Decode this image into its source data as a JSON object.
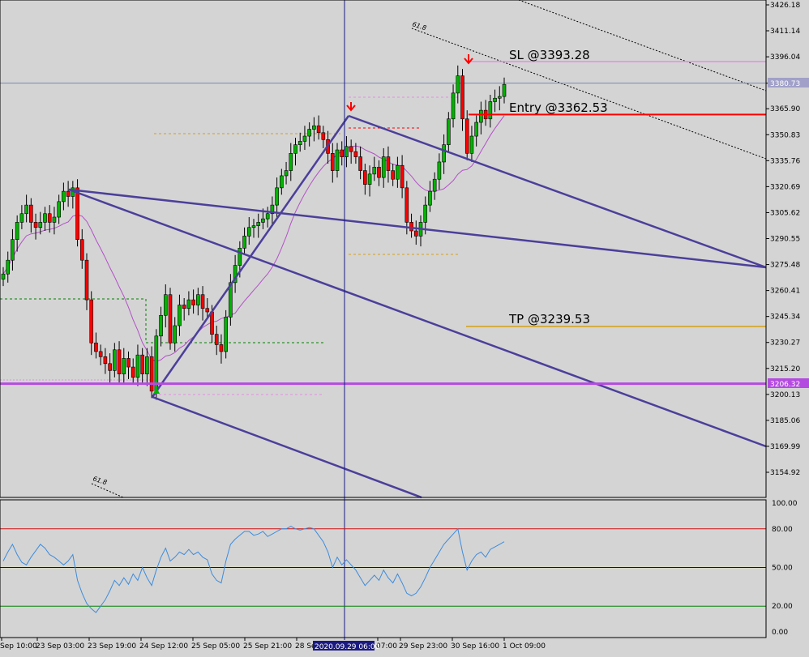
{
  "colors": {
    "background": "#d4d4d4",
    "axis": "#000000",
    "grid_text": "#000000",
    "channel": "#4b3f9a",
    "fib": "#000000",
    "sl_line": "#e58be5",
    "entry_line": "#ff0000",
    "tp_line": "#d4a017",
    "support_line": "#b44be0",
    "ma_line": "#b450c8",
    "rsi_line": "#3c8cdc",
    "rsi_80": "#d01010",
    "rsi_50": "#0000cc",
    "rsi_20": "#008000",
    "crosshair": "#1a1a80",
    "bull_candle": "#00b400",
    "bear_candle": "#ff0000",
    "current_price_bg": "#a0a0c8",
    "support_price_bg": "#b44be0"
  },
  "annotations": {
    "sl": "SL @3393.28",
    "entry": "Entry @3362.53",
    "tp": "TP @3239.53",
    "fib_top": "61.8",
    "fib_bottom": "61.8"
  },
  "price_tags": {
    "current": "3380.73",
    "support": "3206.32"
  },
  "crosshair_time": "2020.09.29 06:00",
  "chart_data": [
    {
      "type": "candlestick",
      "title": "",
      "ylim": [
        3143,
        3435
      ],
      "y_ticks": [
        "3426.18",
        "3411.14",
        "3396.04",
        "3380.73",
        "3365.90",
        "3350.83",
        "3335.76",
        "3320.69",
        "3305.62",
        "3290.55",
        "3275.48",
        "3260.41",
        "3245.34",
        "3230.27",
        "3215.20",
        "3200.13",
        "3185.06",
        "3169.99",
        "3154.92"
      ],
      "x_ticks": [
        "Sep 10:00",
        "23 Sep 03:00",
        "23 Sep 19:00",
        "24 Sep 12:00",
        "25 Sep 05:00",
        "25 Sep 21:00",
        "28 Se",
        "07:00",
        "29 Sep 23:00",
        "30 Sep 16:00",
        "1 Oct 09:00"
      ],
      "levels": {
        "sl": 3393.28,
        "entry": 3362.53,
        "tp": 3239.53,
        "support": 3206.32,
        "current": 3380.73
      },
      "close_series": [
        3270,
        3278,
        3290,
        3300,
        3305,
        3310,
        3300,
        3297,
        3300,
        3305,
        3300,
        3303,
        3312,
        3318,
        3315,
        3320,
        3290,
        3278,
        3255,
        3230,
        3225,
        3222,
        3218,
        3214,
        3226,
        3212,
        3221,
        3216,
        3210,
        3223,
        3212,
        3222,
        3202,
        3234,
        3246,
        3258,
        3230,
        3240,
        3252,
        3250,
        3255,
        3252,
        3258,
        3250,
        3248,
        3235,
        3229,
        3225,
        3245,
        3265,
        3275,
        3285,
        3292,
        3297,
        3298,
        3300,
        3302,
        3305,
        3310,
        3320,
        3327,
        3330,
        3340,
        3345,
        3347,
        3350,
        3354,
        3356,
        3352,
        3348,
        3340,
        3330,
        3342,
        3338,
        3344,
        3341,
        3338,
        3330,
        3322,
        3328,
        3332,
        3326,
        3338,
        3330,
        3325,
        3333,
        3320,
        3300,
        3295,
        3292,
        3300,
        3310,
        3318,
        3325,
        3335,
        3345,
        3360,
        3375,
        3385,
        3360,
        3340,
        3350,
        3358,
        3365,
        3360,
        3370,
        3372,
        3373,
        3380
      ]
    },
    {
      "type": "line",
      "title": "",
      "ylim": [
        0,
        100
      ],
      "y_ticks": [
        "100.00",
        "80.00",
        "50.00",
        "20.00",
        "0.00"
      ],
      "levels": [
        80,
        50,
        20
      ],
      "values": [
        55,
        62,
        68,
        60,
        54,
        52,
        58,
        63,
        68,
        65,
        60,
        58,
        55,
        52,
        55,
        60,
        40,
        30,
        22,
        18,
        15,
        20,
        25,
        32,
        40,
        36,
        42,
        37,
        45,
        40,
        50,
        42,
        36,
        48,
        58,
        65,
        55,
        58,
        62,
        60,
        64,
        60,
        62,
        58,
        56,
        45,
        40,
        38,
        55,
        68,
        72,
        75,
        78,
        78,
        75,
        76,
        78,
        74,
        76,
        78,
        80,
        80,
        82,
        80,
        79,
        80,
        81,
        80,
        75,
        70,
        62,
        50,
        58,
        52,
        56,
        52,
        48,
        42,
        36,
        40,
        44,
        40,
        48,
        42,
        38,
        45,
        38,
        30,
        28,
        30,
        35,
        42,
        50,
        56,
        62,
        68,
        72,
        76,
        80,
        62,
        48,
        55,
        60,
        62,
        58,
        64,
        66,
        68,
        70
      ]
    }
  ]
}
